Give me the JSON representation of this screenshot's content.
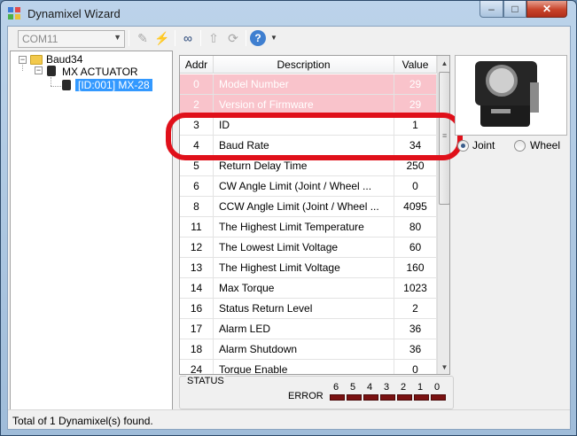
{
  "window": {
    "title": "Dynamixel Wizard",
    "minimize": "–",
    "maximize": "□",
    "close": "✕"
  },
  "toolbar": {
    "port": "COM11",
    "icons": [
      "pencil-icon",
      "plug-icon",
      "search-icon",
      "upload-icon",
      "refresh-icon",
      "help-icon"
    ]
  },
  "tree": {
    "root_label": "Baud34",
    "group_label": "MX ACTUATOR",
    "device_label": "[ID:001] MX-28"
  },
  "table": {
    "headers": {
      "addr": "Addr",
      "description": "Description",
      "value": "Value"
    },
    "rows": [
      {
        "addr": "0",
        "description": "Model Number",
        "value": "29",
        "highlight": true
      },
      {
        "addr": "2",
        "description": "Version of Firmware",
        "value": "29",
        "highlight": true
      },
      {
        "addr": "3",
        "description": "ID",
        "value": "1"
      },
      {
        "addr": "4",
        "description": "Baud Rate",
        "value": "34"
      },
      {
        "addr": "5",
        "description": "Return Delay Time",
        "value": "250"
      },
      {
        "addr": "6",
        "description": "CW Angle Limit (Joint / Wheel ...",
        "value": "0"
      },
      {
        "addr": "8",
        "description": "CCW Angle Limit (Joint / Wheel ...",
        "value": "4095"
      },
      {
        "addr": "11",
        "description": "The Highest Limit Temperature",
        "value": "80"
      },
      {
        "addr": "12",
        "description": "The Lowest Limit Voltage",
        "value": "60"
      },
      {
        "addr": "13",
        "description": "The Highest Limit Voltage",
        "value": "160"
      },
      {
        "addr": "14",
        "description": "Max Torque",
        "value": "1023"
      },
      {
        "addr": "16",
        "description": "Status Return Level",
        "value": "2"
      },
      {
        "addr": "17",
        "description": "Alarm LED",
        "value": "36"
      },
      {
        "addr": "18",
        "description": "Alarm Shutdown",
        "value": "36"
      },
      {
        "addr": "24",
        "description": "Torque Enable",
        "value": "0"
      }
    ]
  },
  "status": {
    "label": "STATUS",
    "error_label": "ERROR",
    "bits": [
      "6",
      "5",
      "4",
      "3",
      "2",
      "1",
      "0"
    ]
  },
  "mode": {
    "joint_label": "Joint",
    "wheel_label": "Wheel",
    "selected": "Joint"
  },
  "statusbar": {
    "text": "Total of 1 Dynamixel(s) found."
  },
  "colors": {
    "highlight_row": "#f9c3cb",
    "annotation": "#e0101a",
    "selection": "#3399ff"
  }
}
